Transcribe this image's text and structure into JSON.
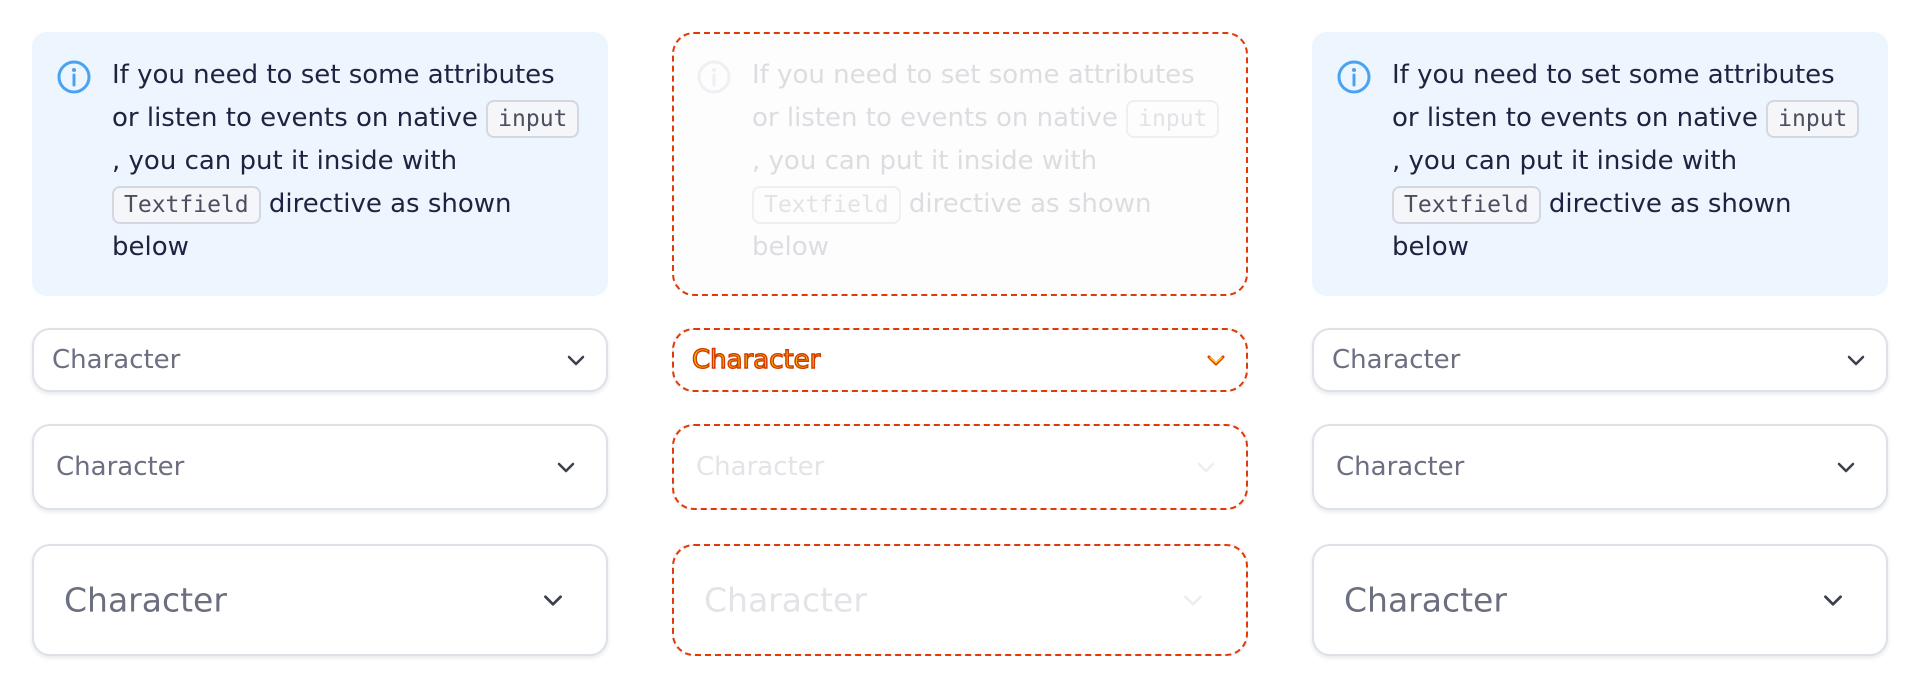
{
  "columns": [
    {
      "callout": {
        "text_1": "If you need to set some attributes or listen to events on native ",
        "code_1": "input",
        "text_2": " , you can put it inside with ",
        "code_2": "Textfield",
        "text_3": " directive as shown below"
      },
      "selects": {
        "small": "Character",
        "medium": "Character",
        "large": "Character"
      }
    },
    {
      "callout": {
        "text_1": "If you need to set some attributes or listen to events on native ",
        "code_1": "input",
        "text_2": " , you can put it inside with ",
        "code_2": "Textfield",
        "text_3": " directive as shown below"
      },
      "selects": {
        "small": "Character",
        "medium": "Character",
        "large": "Character"
      }
    },
    {
      "callout": {
        "text_1": "If you need to set some attributes or listen to events on native ",
        "code_1": "input",
        "text_2": " , you can put it inside with ",
        "code_2": "Textfield",
        "text_3": " directive as shown below"
      },
      "selects": {
        "small": "Character",
        "medium": "Character",
        "large": "Character"
      }
    }
  ],
  "icons": {
    "info": "info-circle-icon",
    "chevron": "chevron-down-icon"
  },
  "colors": {
    "callout_bg": "#edf5fe",
    "info_icon": "#4aa3f0",
    "text": "#1f2340",
    "placeholder": "#6b6f80",
    "highlight_outline": "#e03a0a",
    "highlight_fill": "#f5d400"
  }
}
